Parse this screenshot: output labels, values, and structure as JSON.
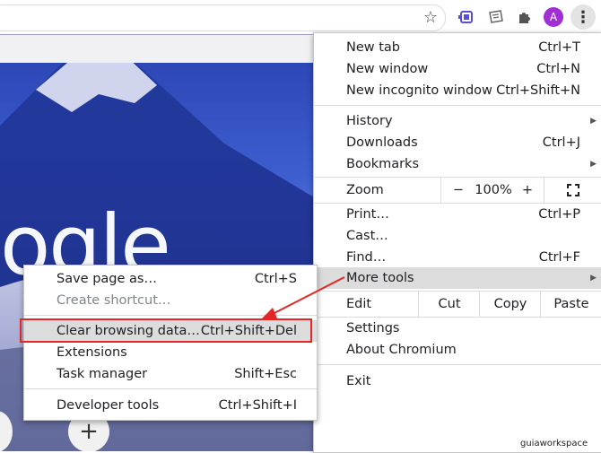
{
  "toolbar": {
    "avatar_letter": "A",
    "star_icon": "star-icon",
    "puzzle_icon": "puzzle-icon",
    "kebab_icon": "kebab-icon"
  },
  "scene": {
    "logo_text": "ogle",
    "watermark": "guiaworkspace"
  },
  "menu": {
    "new_tab": {
      "label": "New tab",
      "shortcut": "Ctrl+T"
    },
    "new_window": {
      "label": "New window",
      "shortcut": "Ctrl+N"
    },
    "new_incognito": {
      "label": "New incognito window",
      "shortcut": "Ctrl+Shift+N"
    },
    "history": {
      "label": "History"
    },
    "downloads": {
      "label": "Downloads",
      "shortcut": "Ctrl+J"
    },
    "bookmarks": {
      "label": "Bookmarks"
    },
    "zoom": {
      "label": "Zoom",
      "minus": "−",
      "value": "100%",
      "plus": "+"
    },
    "print": {
      "label": "Print…",
      "shortcut": "Ctrl+P"
    },
    "cast": {
      "label": "Cast…"
    },
    "find": {
      "label": "Find…",
      "shortcut": "Ctrl+F"
    },
    "more_tools": {
      "label": "More tools"
    },
    "edit": {
      "label": "Edit",
      "cut": "Cut",
      "copy": "Copy",
      "paste": "Paste"
    },
    "settings": {
      "label": "Settings"
    },
    "about": {
      "label": "About Chromium"
    },
    "exit": {
      "label": "Exit"
    }
  },
  "submenu": {
    "save_page": {
      "label": "Save page as…",
      "shortcut": "Ctrl+S"
    },
    "create_shortcut": {
      "label": "Create shortcut…"
    },
    "clear_browsing": {
      "label": "Clear browsing data…",
      "shortcut": "Ctrl+Shift+Del"
    },
    "extensions": {
      "label": "Extensions"
    },
    "task_manager": {
      "label": "Task manager",
      "shortcut": "Shift+Esc"
    },
    "developer_tools": {
      "label": "Developer tools",
      "shortcut": "Ctrl+Shift+I"
    }
  },
  "colors": {
    "highlight_box": "#e32626",
    "avatar": "#a12fd6"
  }
}
